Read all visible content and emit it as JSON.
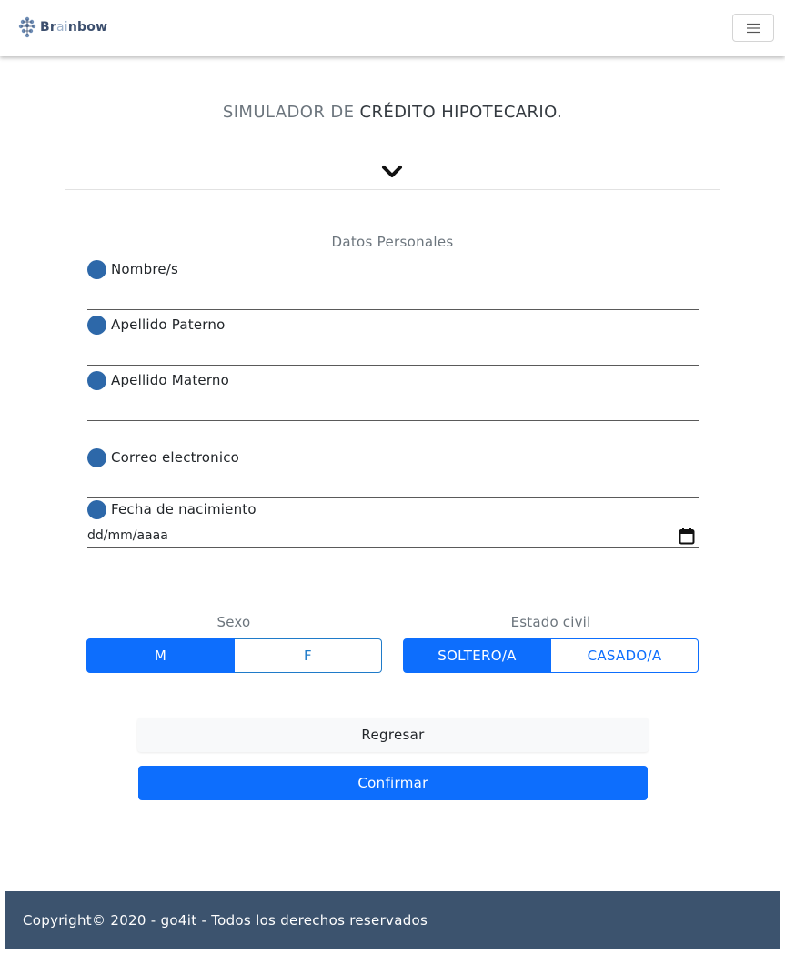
{
  "navbar": {
    "brand_prefix": "Br",
    "brand_ai": "ai",
    "brand_suffix": "nbow",
    "logo_icon": "brain-icon",
    "menu_icon": "hamburger-icon"
  },
  "hero": {
    "title_muted": "SIMULADOR DE ",
    "title_dark": "CRÉDITO HIPOTECARIO.",
    "chevron_icon": "chevron-down-icon"
  },
  "form": {
    "section_title": "Datos Personales",
    "fields": [
      {
        "label": "Nombre/s",
        "value": ""
      },
      {
        "label": "Apellido Paterno",
        "value": ""
      },
      {
        "label": "Apellido Materno",
        "value": ""
      },
      {
        "label": "Correo electronico",
        "value": ""
      },
      {
        "label": "Fecha de nacimiento",
        "value": "dd/mm/aaaa"
      }
    ],
    "sexo": {
      "label": "Sexo",
      "options": [
        "M",
        "F"
      ],
      "selected": "M"
    },
    "estado_civil": {
      "label": "Estado civil",
      "options": [
        "SOLTERO/A",
        "CASADO/A"
      ],
      "selected": "SOLTERO/A"
    },
    "back_label": "Regresar",
    "confirm_label": "Confirmar"
  },
  "footer": {
    "text": "Copyright© 2020 - go4it - Todos los derechos reservados"
  },
  "colors": {
    "primary": "#0d6efd",
    "bullet": "#2d68a9",
    "footer_bg": "#3c536e"
  }
}
